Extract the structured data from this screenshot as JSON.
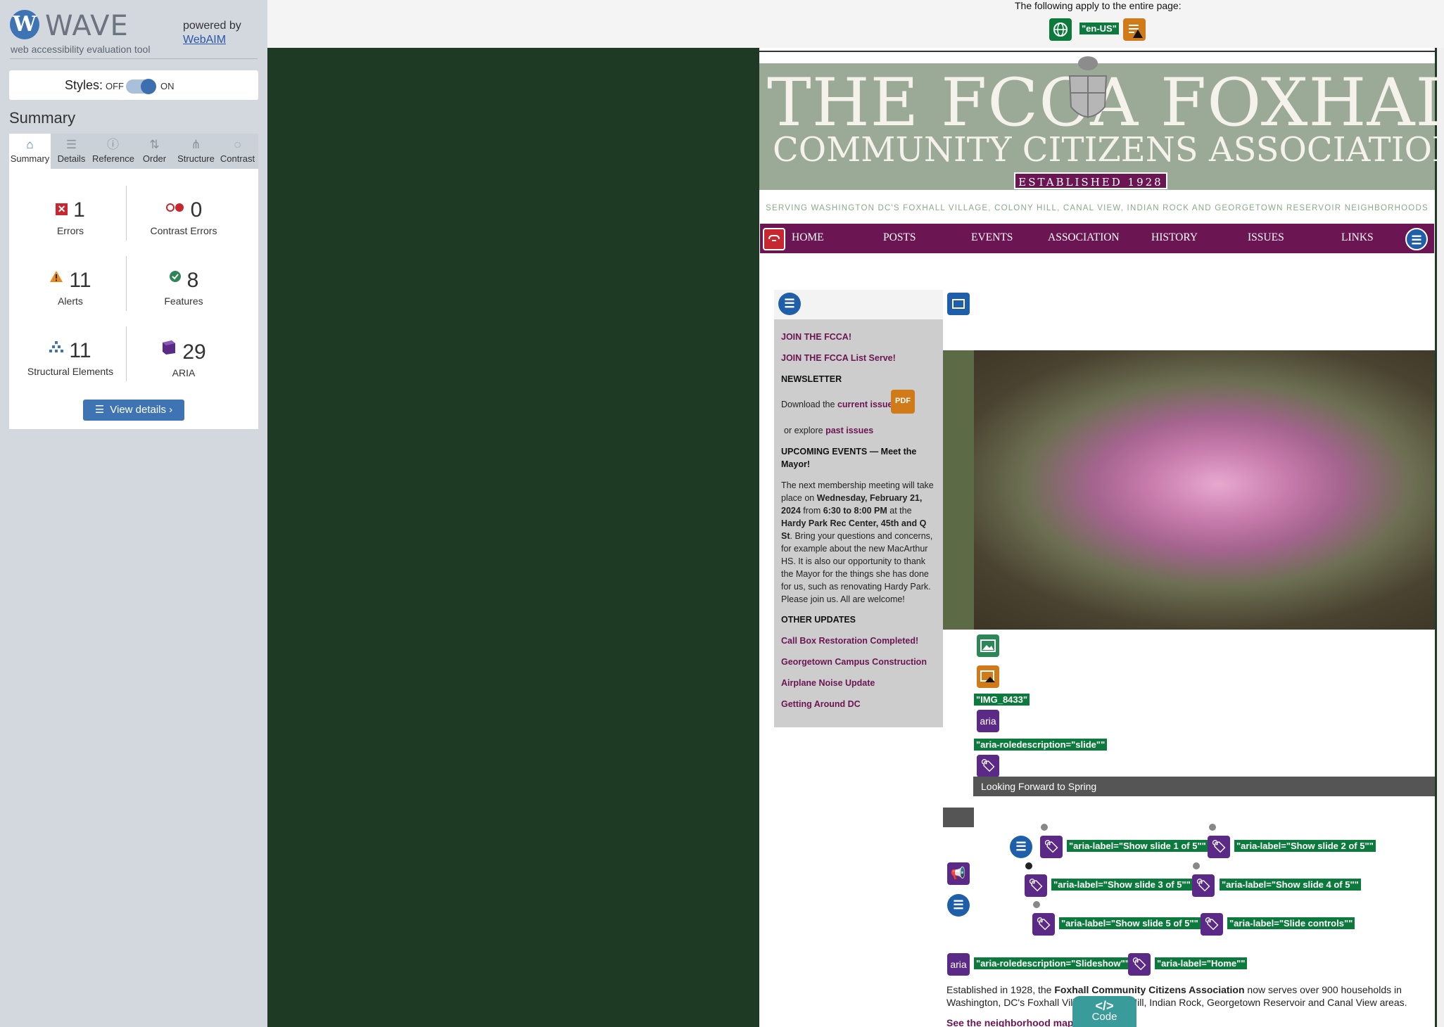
{
  "wave": {
    "logo_letter": "W",
    "title": "WAVE",
    "subtitle": "web accessibility evaluation tool",
    "powered_by": "powered by",
    "webaim_link": "WebAIM",
    "styles_label": "Styles:",
    "styles_off": "OFF",
    "styles_on": "ON",
    "summary_heading": "Summary",
    "tabs": [
      {
        "label": "Summary",
        "icon": "⌂"
      },
      {
        "label": "Details",
        "icon": "☰"
      },
      {
        "label": "Reference",
        "icon": "ⓘ"
      },
      {
        "label": "Order",
        "icon": "⇅"
      },
      {
        "label": "Structure",
        "icon": "⋔"
      },
      {
        "label": "Contrast",
        "icon": "◌"
      }
    ],
    "stats": {
      "errors": {
        "count": "1",
        "label": "Errors"
      },
      "contrast_errors": {
        "count": "0",
        "label": "Contrast Errors"
      },
      "alerts": {
        "count": "11",
        "label": "Alerts"
      },
      "features": {
        "count": "8",
        "label": "Features"
      },
      "structural": {
        "count": "11",
        "label": "Structural Elements"
      },
      "aria": {
        "count": "29",
        "label": "ARIA"
      }
    },
    "view_details": "View details ›",
    "code_tab": "Code",
    "code_icon": "</>"
  },
  "page_top": {
    "note": "The following apply to the entire page:",
    "lang_tag": "\"en-US\""
  },
  "site": {
    "banner_line1": "THE FCCA  FOXHALL",
    "banner_line2": "COMMUNITY CITIZENS ASSOCIATION",
    "established": "ESTABLISHED 1928",
    "serving": "SERVING WASHINGTON DC'S FOXHALL VILLAGE, COLONY HILL, CANAL VIEW, INDIAN ROCK AND GEORGETOWN RESERVOIR NEIGHBORHOODS",
    "nav": [
      "HOME",
      "POSTS",
      "EVENTS",
      "ASSOCIATION",
      "HISTORY",
      "ISSUES",
      "LINKS"
    ],
    "sidebar": {
      "join": "JOIN THE FCCA!",
      "join_list": "JOIN THE FCCA List Serve!",
      "newsletter": "NEWSLETTER",
      "download_text": "Download the",
      "current_issue": "current issue",
      "explore_text": "or explore",
      "past_issues": "past issues",
      "upcoming": "UPCOMING EVENTS — Meet the Mayor!",
      "event_1": "The next membership meeting will take place on",
      "event_date": "Wednesday, February 21, 2024",
      "event_from": "from",
      "event_time": "6:30 to 8:00 PM",
      "event_at": "at the",
      "event_place": "Hardy Park Rec Center, 45th and Q St",
      "event_2": ". Bring your questions and concerns, for example about the new MacArthur HS. It is also our opportunity to thank the Mayor for the things she has done for us, such as renovating Hardy Park. Please join us. All are welcome!",
      "other_updates": "OTHER UPDATES",
      "updates": [
        "Call Box Restoration Completed!",
        "Georgetown Campus Construction",
        "Airplane Noise Update",
        "Getting Around DC"
      ]
    },
    "slide": {
      "img_alt": "\"IMG_8433\"",
      "roledesc_slide": "\"aria-roledescription=\"slide\"\"",
      "caption": "Looking Forward to Spring",
      "slide_labels": [
        "\"aria-label=\"Show slide 1 of 5\"\"",
        "\"aria-label=\"Show slide 2 of 5\"\"",
        "\"aria-label=\"Show slide 3 of 5\"\"",
        "\"aria-label=\"Show slide 4 of 5\"\"",
        "\"aria-label=\"Show slide 5 of 5\"\""
      ],
      "controls_label": "\"aria-label=\"Slide controls\"\"",
      "roledesc_slideshow": "\"aria-roledescription=\"Slideshow\"\"",
      "home_label": "\"aria-label=\"Home\"\"",
      "aria_text": "aria"
    },
    "intro_a": "Established in 1928, the",
    "intro_bold": "Foxhall Community Citizens Association",
    "intro_b": "now serves over 900 households in Washington, DC's Foxhall Village, Colony Hill, Indian Rock, Georgetown Reservoir and Canal View areas.",
    "see_map": "See the neighborhood map"
  },
  "colors": {
    "wave_blue": "#3f74b4",
    "site_maroon": "#6b1552",
    "banner_green": "#9aaa97",
    "tag_green": "#0c7a3c",
    "aria_purple": "#5a2a86",
    "page_bg": "#1e3a24"
  }
}
